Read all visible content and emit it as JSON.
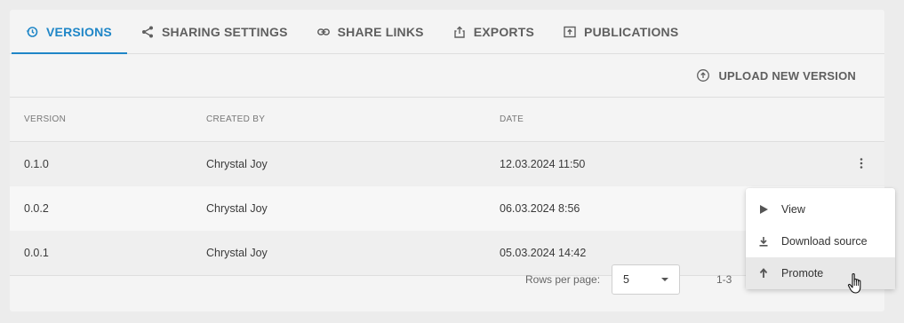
{
  "tabs": [
    {
      "label": "VERSIONS",
      "icon": "history-icon",
      "active": true
    },
    {
      "label": "SHARING SETTINGS",
      "icon": "share-icon",
      "active": false
    },
    {
      "label": "SHARE LINKS",
      "icon": "link-icon",
      "active": false
    },
    {
      "label": "EXPORTS",
      "icon": "export-icon",
      "active": false
    },
    {
      "label": "PUBLICATIONS",
      "icon": "publication-icon",
      "active": false
    }
  ],
  "toolbar": {
    "upload_label": "UPLOAD NEW VERSION"
  },
  "table": {
    "headers": [
      "VERSION",
      "CREATED BY",
      "DATE"
    ],
    "rows": [
      {
        "version": "0.1.0",
        "created_by": "Chrystal Joy",
        "date": "12.03.2024 11:50"
      },
      {
        "version": "0.0.2",
        "created_by": "Chrystal Joy",
        "date": "06.03.2024 8:56"
      },
      {
        "version": "0.0.1",
        "created_by": "Chrystal Joy",
        "date": "05.03.2024 14:42"
      }
    ]
  },
  "pagination": {
    "rows_per_page_label": "Rows per page:",
    "rows_per_page_value": "5",
    "range_text": "1-3"
  },
  "context_menu": {
    "items": [
      {
        "label": "View",
        "icon": "play-icon"
      },
      {
        "label": "Download source",
        "icon": "download-icon"
      },
      {
        "label": "Promote",
        "icon": "arrow-up-icon",
        "hovered": true
      }
    ]
  },
  "colors": {
    "accent": "#1f86c7",
    "background": "#ececec",
    "panel": "#f4f4f4"
  }
}
